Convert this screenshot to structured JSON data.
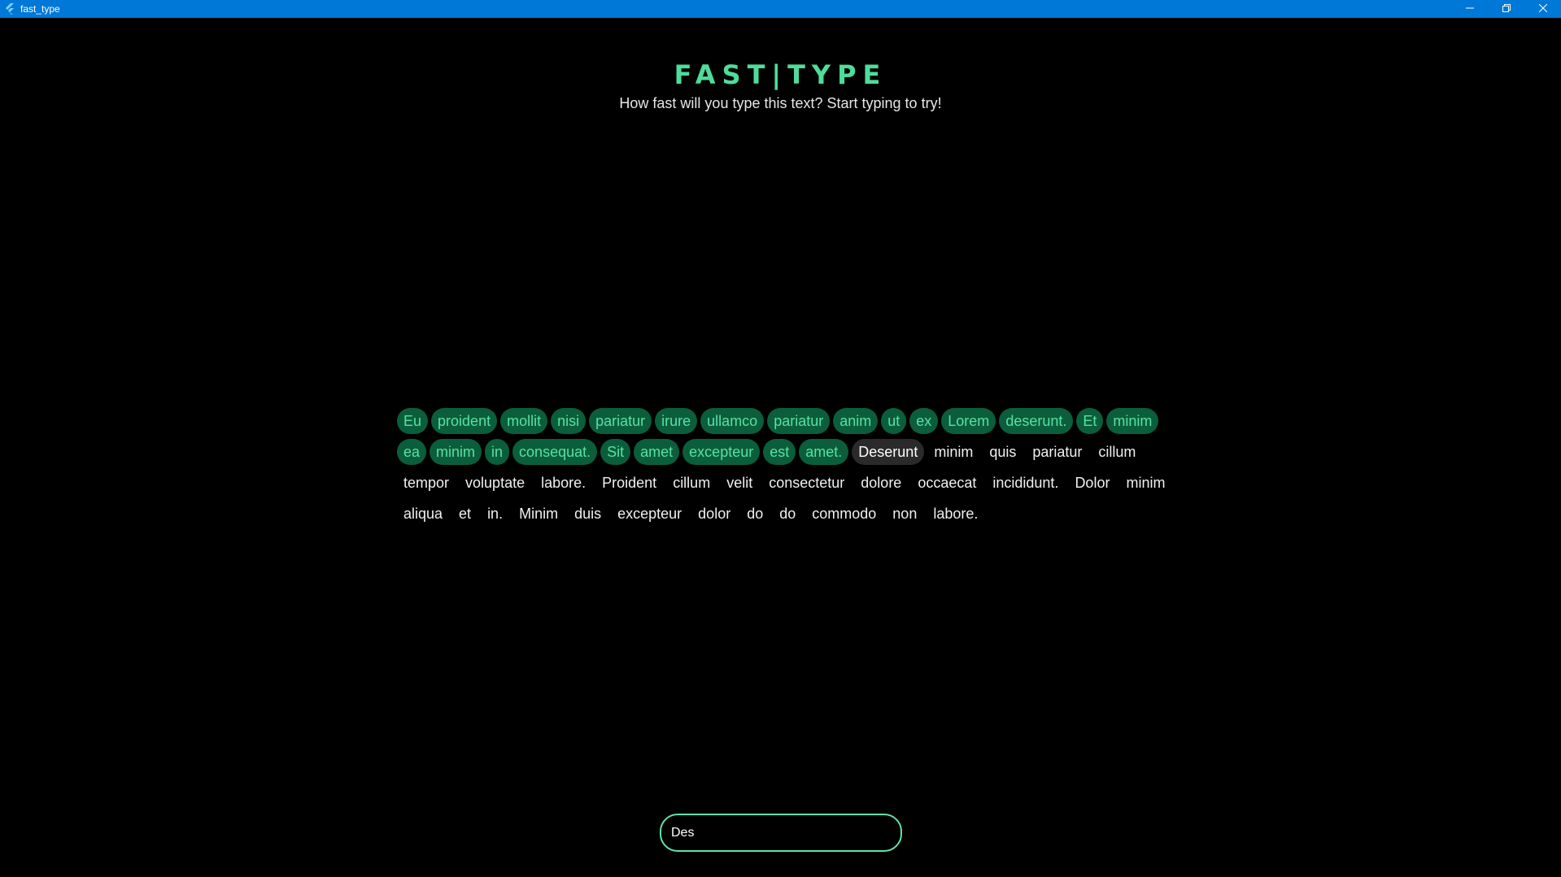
{
  "window": {
    "title": "fast_type",
    "controls": [
      "minimize-icon",
      "restore-icon",
      "close-icon"
    ]
  },
  "header": {
    "logo": "FAST|TYPE",
    "subtitle": "How fast will you type this text? Start typing to try!"
  },
  "colors": {
    "accent": "#4fdc9b",
    "done_word_bg": "#0b5e3b",
    "current_word_bg": "#2a2a2a",
    "titlebar": "#0078d7"
  },
  "words": [
    {
      "text": "Eu",
      "state": "done"
    },
    {
      "text": "proident",
      "state": "done"
    },
    {
      "text": "mollit",
      "state": "done"
    },
    {
      "text": "nisi",
      "state": "done"
    },
    {
      "text": "pariatur",
      "state": "done"
    },
    {
      "text": "irure",
      "state": "done"
    },
    {
      "text": "ullamco",
      "state": "done"
    },
    {
      "text": "pariatur",
      "state": "done"
    },
    {
      "text": "anim",
      "state": "done"
    },
    {
      "text": "ut",
      "state": "done"
    },
    {
      "text": "ex",
      "state": "done"
    },
    {
      "text": "Lorem",
      "state": "done"
    },
    {
      "text": "deserunt.",
      "state": "done"
    },
    {
      "text": "Et",
      "state": "done"
    },
    {
      "text": "minim",
      "state": "done"
    },
    {
      "text": "ea",
      "state": "done"
    },
    {
      "text": "minim",
      "state": "done"
    },
    {
      "text": "in",
      "state": "done"
    },
    {
      "text": "consequat.",
      "state": "done"
    },
    {
      "text": "Sit",
      "state": "done"
    },
    {
      "text": "amet",
      "state": "done"
    },
    {
      "text": "excepteur",
      "state": "done"
    },
    {
      "text": "est",
      "state": "done"
    },
    {
      "text": "amet.",
      "state": "done"
    },
    {
      "text": "Deserunt",
      "state": "current"
    },
    {
      "text": "minim",
      "state": "pending"
    },
    {
      "text": "quis",
      "state": "pending"
    },
    {
      "text": "pariatur",
      "state": "pending"
    },
    {
      "text": "cillum",
      "state": "pending"
    },
    {
      "text": "tempor",
      "state": "pending"
    },
    {
      "text": "voluptate",
      "state": "pending"
    },
    {
      "text": "labore.",
      "state": "pending"
    },
    {
      "text": "Proident",
      "state": "pending"
    },
    {
      "text": "cillum",
      "state": "pending"
    },
    {
      "text": "velit",
      "state": "pending"
    },
    {
      "text": "consectetur",
      "state": "pending"
    },
    {
      "text": "dolore",
      "state": "pending"
    },
    {
      "text": "occaecat",
      "state": "pending"
    },
    {
      "text": "incididunt.",
      "state": "pending"
    },
    {
      "text": "Dolor",
      "state": "pending"
    },
    {
      "text": "minim",
      "state": "pending"
    },
    {
      "text": "aliqua",
      "state": "pending"
    },
    {
      "text": "et",
      "state": "pending"
    },
    {
      "text": "in.",
      "state": "pending"
    },
    {
      "text": "Minim",
      "state": "pending"
    },
    {
      "text": "duis",
      "state": "pending"
    },
    {
      "text": "excepteur",
      "state": "pending"
    },
    {
      "text": "dolor",
      "state": "pending"
    },
    {
      "text": "do",
      "state": "pending"
    },
    {
      "text": "do",
      "state": "pending"
    },
    {
      "text": "commodo",
      "state": "pending"
    },
    {
      "text": "non",
      "state": "pending"
    },
    {
      "text": "labore.",
      "state": "pending"
    }
  ],
  "input": {
    "value": "Des"
  }
}
